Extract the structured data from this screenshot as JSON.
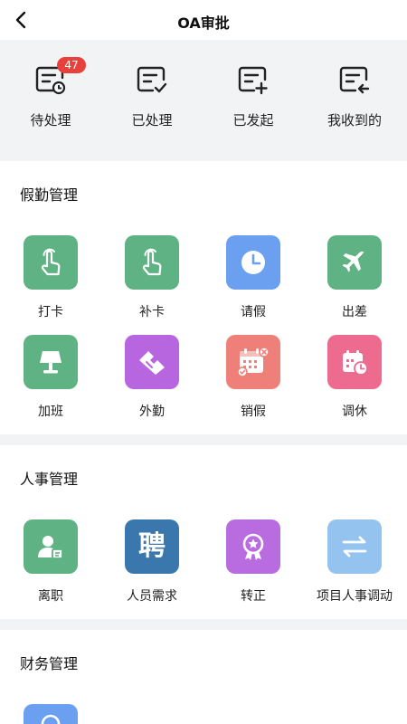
{
  "header": {
    "title": "OA审批"
  },
  "quick_actions": [
    {
      "label": "待处理",
      "icon": "pending-doc-icon",
      "badge": "47"
    },
    {
      "label": "已处理",
      "icon": "processed-doc-icon"
    },
    {
      "label": "已发起",
      "icon": "initiated-doc-icon"
    },
    {
      "label": "我收到的",
      "icon": "received-doc-icon"
    }
  ],
  "sections": {
    "attendance": {
      "title": "假勤管理",
      "items": [
        {
          "label": "打卡",
          "icon": "tap-hand-icon",
          "color": "#5fb283"
        },
        {
          "label": "补卡",
          "icon": "tap-hand-icon",
          "color": "#5fb283"
        },
        {
          "label": "请假",
          "icon": "clock-icon",
          "color": "#6b9ff0"
        },
        {
          "label": "出差",
          "icon": "airplane-icon",
          "color": "#5fb283"
        },
        {
          "label": "加班",
          "icon": "lamp-icon",
          "color": "#5fb283"
        },
        {
          "label": "外勤",
          "icon": "handshake-icon",
          "color": "#b866e0"
        },
        {
          "label": "销假",
          "icon": "calendar-cancel-icon",
          "color": "#ef8079"
        },
        {
          "label": "调休",
          "icon": "calendar-clock-icon",
          "color": "#ec6b8f"
        }
      ]
    },
    "hr": {
      "title": "人事管理",
      "items": [
        {
          "label": "离职",
          "icon": "resign-person-icon",
          "color": "#5fb283"
        },
        {
          "label": "人员需求",
          "icon": "hire-char-icon",
          "text": "聘",
          "color": "#3977ad"
        },
        {
          "label": "转正",
          "icon": "award-icon",
          "color": "#b96ce0"
        },
        {
          "label": "项目人事调动",
          "icon": "transfer-arrows-icon",
          "color": "#93c3ee"
        }
      ]
    },
    "finance": {
      "title": "财务管理"
    }
  }
}
